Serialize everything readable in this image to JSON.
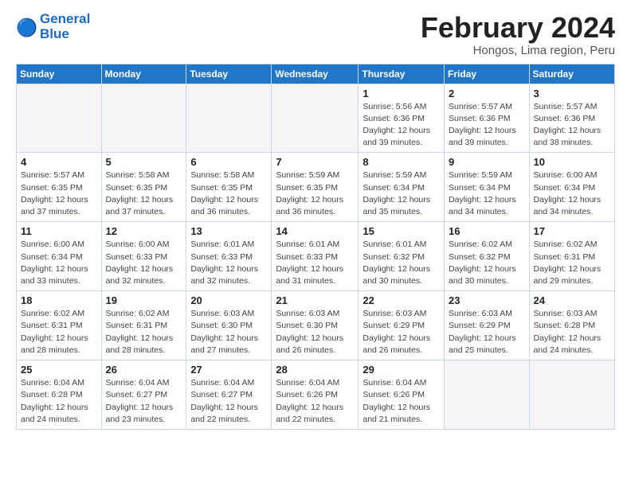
{
  "logo": {
    "line1": "General",
    "line2": "Blue",
    "icon": "🔵"
  },
  "title": "February 2024",
  "subtitle": "Hongos, Lima region, Peru",
  "days_of_week": [
    "Sunday",
    "Monday",
    "Tuesday",
    "Wednesday",
    "Thursday",
    "Friday",
    "Saturday"
  ],
  "weeks": [
    [
      {
        "day": "",
        "info": ""
      },
      {
        "day": "",
        "info": ""
      },
      {
        "day": "",
        "info": ""
      },
      {
        "day": "",
        "info": ""
      },
      {
        "day": "1",
        "info": "Sunrise: 5:56 AM\nSunset: 6:36 PM\nDaylight: 12 hours\nand 39 minutes."
      },
      {
        "day": "2",
        "info": "Sunrise: 5:57 AM\nSunset: 6:36 PM\nDaylight: 12 hours\nand 39 minutes."
      },
      {
        "day": "3",
        "info": "Sunrise: 5:57 AM\nSunset: 6:36 PM\nDaylight: 12 hours\nand 38 minutes."
      }
    ],
    [
      {
        "day": "4",
        "info": "Sunrise: 5:57 AM\nSunset: 6:35 PM\nDaylight: 12 hours\nand 37 minutes."
      },
      {
        "day": "5",
        "info": "Sunrise: 5:58 AM\nSunset: 6:35 PM\nDaylight: 12 hours\nand 37 minutes."
      },
      {
        "day": "6",
        "info": "Sunrise: 5:58 AM\nSunset: 6:35 PM\nDaylight: 12 hours\nand 36 minutes."
      },
      {
        "day": "7",
        "info": "Sunrise: 5:59 AM\nSunset: 6:35 PM\nDaylight: 12 hours\nand 36 minutes."
      },
      {
        "day": "8",
        "info": "Sunrise: 5:59 AM\nSunset: 6:34 PM\nDaylight: 12 hours\nand 35 minutes."
      },
      {
        "day": "9",
        "info": "Sunrise: 5:59 AM\nSunset: 6:34 PM\nDaylight: 12 hours\nand 34 minutes."
      },
      {
        "day": "10",
        "info": "Sunrise: 6:00 AM\nSunset: 6:34 PM\nDaylight: 12 hours\nand 34 minutes."
      }
    ],
    [
      {
        "day": "11",
        "info": "Sunrise: 6:00 AM\nSunset: 6:34 PM\nDaylight: 12 hours\nand 33 minutes."
      },
      {
        "day": "12",
        "info": "Sunrise: 6:00 AM\nSunset: 6:33 PM\nDaylight: 12 hours\nand 32 minutes."
      },
      {
        "day": "13",
        "info": "Sunrise: 6:01 AM\nSunset: 6:33 PM\nDaylight: 12 hours\nand 32 minutes."
      },
      {
        "day": "14",
        "info": "Sunrise: 6:01 AM\nSunset: 6:33 PM\nDaylight: 12 hours\nand 31 minutes."
      },
      {
        "day": "15",
        "info": "Sunrise: 6:01 AM\nSunset: 6:32 PM\nDaylight: 12 hours\nand 30 minutes."
      },
      {
        "day": "16",
        "info": "Sunrise: 6:02 AM\nSunset: 6:32 PM\nDaylight: 12 hours\nand 30 minutes."
      },
      {
        "day": "17",
        "info": "Sunrise: 6:02 AM\nSunset: 6:31 PM\nDaylight: 12 hours\nand 29 minutes."
      }
    ],
    [
      {
        "day": "18",
        "info": "Sunrise: 6:02 AM\nSunset: 6:31 PM\nDaylight: 12 hours\nand 28 minutes."
      },
      {
        "day": "19",
        "info": "Sunrise: 6:02 AM\nSunset: 6:31 PM\nDaylight: 12 hours\nand 28 minutes."
      },
      {
        "day": "20",
        "info": "Sunrise: 6:03 AM\nSunset: 6:30 PM\nDaylight: 12 hours\nand 27 minutes."
      },
      {
        "day": "21",
        "info": "Sunrise: 6:03 AM\nSunset: 6:30 PM\nDaylight: 12 hours\nand 26 minutes."
      },
      {
        "day": "22",
        "info": "Sunrise: 6:03 AM\nSunset: 6:29 PM\nDaylight: 12 hours\nand 26 minutes."
      },
      {
        "day": "23",
        "info": "Sunrise: 6:03 AM\nSunset: 6:29 PM\nDaylight: 12 hours\nand 25 minutes."
      },
      {
        "day": "24",
        "info": "Sunrise: 6:03 AM\nSunset: 6:28 PM\nDaylight: 12 hours\nand 24 minutes."
      }
    ],
    [
      {
        "day": "25",
        "info": "Sunrise: 6:04 AM\nSunset: 6:28 PM\nDaylight: 12 hours\nand 24 minutes."
      },
      {
        "day": "26",
        "info": "Sunrise: 6:04 AM\nSunset: 6:27 PM\nDaylight: 12 hours\nand 23 minutes."
      },
      {
        "day": "27",
        "info": "Sunrise: 6:04 AM\nSunset: 6:27 PM\nDaylight: 12 hours\nand 22 minutes."
      },
      {
        "day": "28",
        "info": "Sunrise: 6:04 AM\nSunset: 6:26 PM\nDaylight: 12 hours\nand 22 minutes."
      },
      {
        "day": "29",
        "info": "Sunrise: 6:04 AM\nSunset: 6:26 PM\nDaylight: 12 hours\nand 21 minutes."
      },
      {
        "day": "",
        "info": ""
      },
      {
        "day": "",
        "info": ""
      }
    ]
  ]
}
